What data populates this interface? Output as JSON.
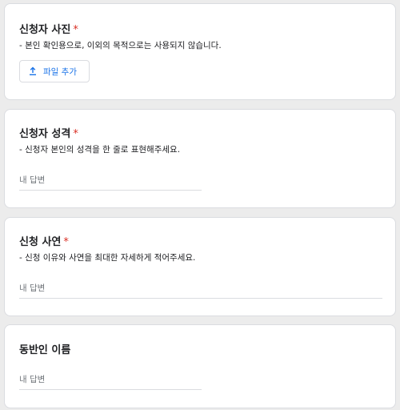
{
  "questions": [
    {
      "title": "신청자 사진",
      "required_mark": "*",
      "description": "- 본인 확인용으로, 이외의 목적으로는 사용되지 않습니다.",
      "upload_label": "파일 추가",
      "upload_icon": "upload-icon"
    },
    {
      "title": "신청자 성격",
      "required_mark": "*",
      "description": "- 신청자 본인의 성격을 한 줄로 표현해주세요.",
      "answer_placeholder": "내 답변"
    },
    {
      "title": "신청 사연",
      "required_mark": "*",
      "description": "- 신청 이유와 사연을 최대한 자세하게 적어주세요.",
      "answer_placeholder": "내 답변"
    },
    {
      "title": "동반인 이름",
      "answer_placeholder": "내 답변"
    }
  ],
  "colors": {
    "required": "#d93025",
    "accent": "#1a73e8",
    "background": "#ececec"
  }
}
